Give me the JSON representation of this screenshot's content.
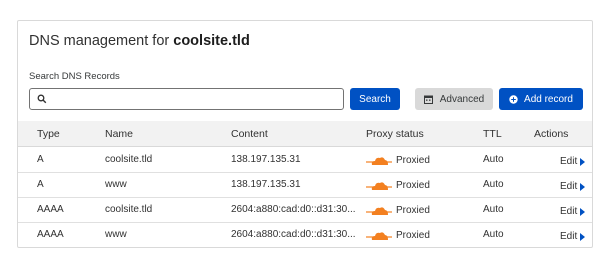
{
  "header": {
    "title_prefix": "DNS management for ",
    "domain": "coolsite.tld"
  },
  "search": {
    "label": "Search DNS Records",
    "value": "",
    "placeholder": "",
    "icon": "search-icon"
  },
  "toolbar": {
    "search_label": "Search",
    "advanced_label": "Advanced",
    "add_label": "Add record"
  },
  "table": {
    "columns": [
      "Type",
      "Name",
      "Content",
      "Proxy status",
      "TTL",
      "Actions"
    ],
    "rows": [
      {
        "type": "A",
        "name": "coolsite.tld",
        "content": "138.197.135.31",
        "proxy": "Proxied",
        "ttl": "Auto",
        "action": "Edit"
      },
      {
        "type": "A",
        "name": "www",
        "content": "138.197.135.31",
        "proxy": "Proxied",
        "ttl": "Auto",
        "action": "Edit"
      },
      {
        "type": "AAAA",
        "name": "coolsite.tld",
        "content": "2604:a880:cad:d0::d31:30...",
        "proxy": "Proxied",
        "ttl": "Auto",
        "action": "Edit"
      },
      {
        "type": "AAAA",
        "name": "www",
        "content": "2604:a880:cad:d0::d31:30...",
        "proxy": "Proxied",
        "ttl": "Auto",
        "action": "Edit"
      }
    ]
  },
  "colors": {
    "primary": "#0051c3",
    "cloud": "#f38020",
    "header_bg": "#f2f2f2"
  }
}
